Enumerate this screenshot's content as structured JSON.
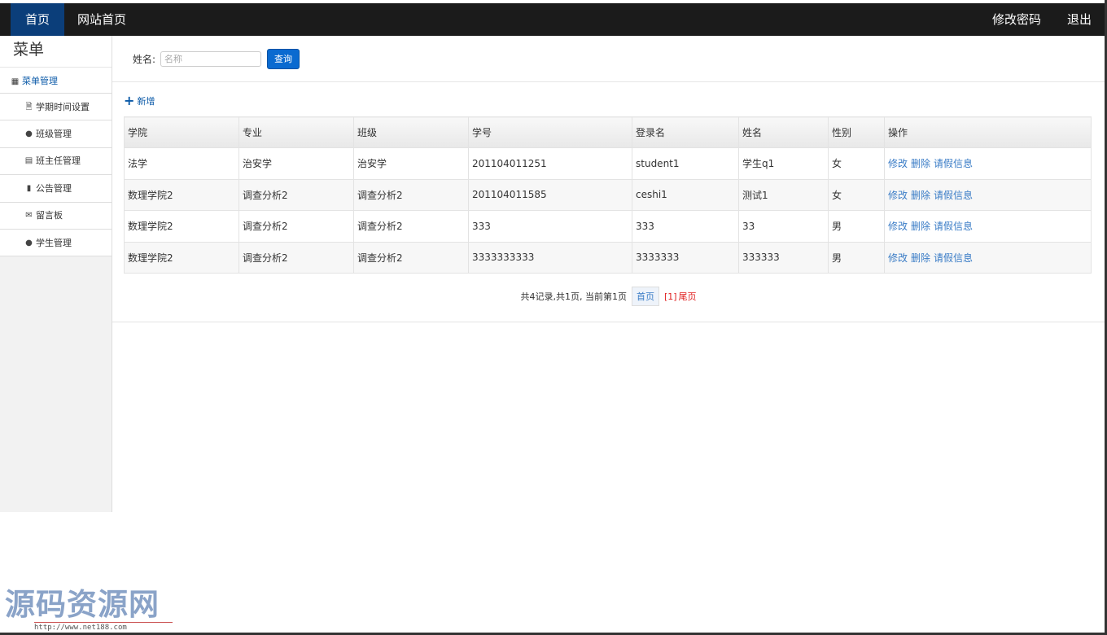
{
  "topnav": {
    "home": "首页",
    "site_home": "网站首页",
    "change_password": "修改密码",
    "logout": "退出"
  },
  "sidebar": {
    "title": "菜单",
    "group": "菜单管理",
    "items": [
      {
        "label": "学期时间设置",
        "icon": "file-icon"
      },
      {
        "label": "班级管理",
        "icon": "comment-icon"
      },
      {
        "label": "班主任管理",
        "icon": "list-icon"
      },
      {
        "label": "公告管理",
        "icon": "books-icon"
      },
      {
        "label": "留言板",
        "icon": "envelope-icon"
      },
      {
        "label": "学生管理",
        "icon": "comment-icon"
      }
    ]
  },
  "search": {
    "label": "姓名:",
    "placeholder": "名称",
    "button": "查询"
  },
  "add_label": "新增",
  "table": {
    "headers": [
      "学院",
      "专业",
      "班级",
      "学号",
      "登录名",
      "姓名",
      "性别",
      "操作"
    ],
    "rows": [
      [
        "法学",
        "治安学",
        "治安学",
        "201104011251",
        "student1",
        "学生q1",
        "女"
      ],
      [
        "数理学院2",
        "调查分析2",
        "调查分析2",
        "201104011585",
        "ceshi1",
        "测试1",
        "女"
      ],
      [
        "数理学院2",
        "调查分析2",
        "调查分析2",
        "333",
        "333",
        "33",
        "男"
      ],
      [
        "数理学院2",
        "调查分析2",
        "调查分析2",
        "3333333333",
        "3333333",
        "333333",
        "男"
      ]
    ],
    "ops": {
      "edit": "修改",
      "delete": "删除",
      "leave": "请假信息"
    }
  },
  "pager": {
    "summary": "共4记录,共1页, 当前第1页",
    "first": "首页",
    "current": "[1]",
    "last": "尾页"
  },
  "watermark": {
    "title": "源码资源网",
    "url": "http://www.net188.com"
  },
  "colors": {
    "topbar": "#1b1b1b",
    "active_nav": "#0b3e7a",
    "link": "#3a7cc6",
    "button": "#0a6ad0"
  }
}
